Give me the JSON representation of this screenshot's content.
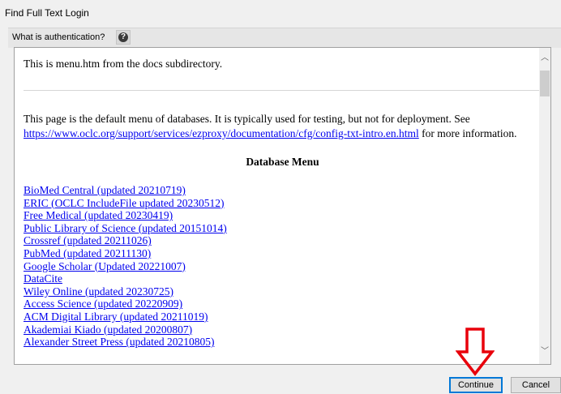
{
  "window": {
    "title": "Find Full Text Login"
  },
  "toolbar": {
    "auth_label": "What is authentication?",
    "help_icon": "question-circle-icon"
  },
  "content": {
    "intro": "This is menu.htm from the docs subdirectory.",
    "para_text": "This page is the default menu of databases. It is typically used for testing, but not for deployment. See ",
    "para_link": "https://www.oclc.org/support/services/ezproxy/documentation/cfg/config-txt-intro.en.html",
    "para_tail": " for more information.",
    "heading": "Database Menu",
    "databases": [
      "BioMed Central (updated 20210719)",
      "ERIC (OCLC IncludeFile updated 20230512)",
      "Free Medical (updated 20230419)",
      "Public Library of Science (updated 20151014)",
      "Crossref (updated 20211026)",
      "PubMed (updated 20211130)",
      "Google Scholar (Updated 20221007)",
      "DataCite",
      "Wiley Online (updated 20230725)",
      "Access Science (updated 20220909)",
      "ACM Digital Library (updated 20211019)",
      "Akademiai Kiado (updated 20200807)",
      "Alexander Street Press (updated 20210805)"
    ]
  },
  "buttons": {
    "continue": "Continue",
    "cancel": "Cancel"
  },
  "colors": {
    "link": "#0000ee",
    "annotation_arrow": "#e8000b",
    "focus": "#0078d7"
  }
}
